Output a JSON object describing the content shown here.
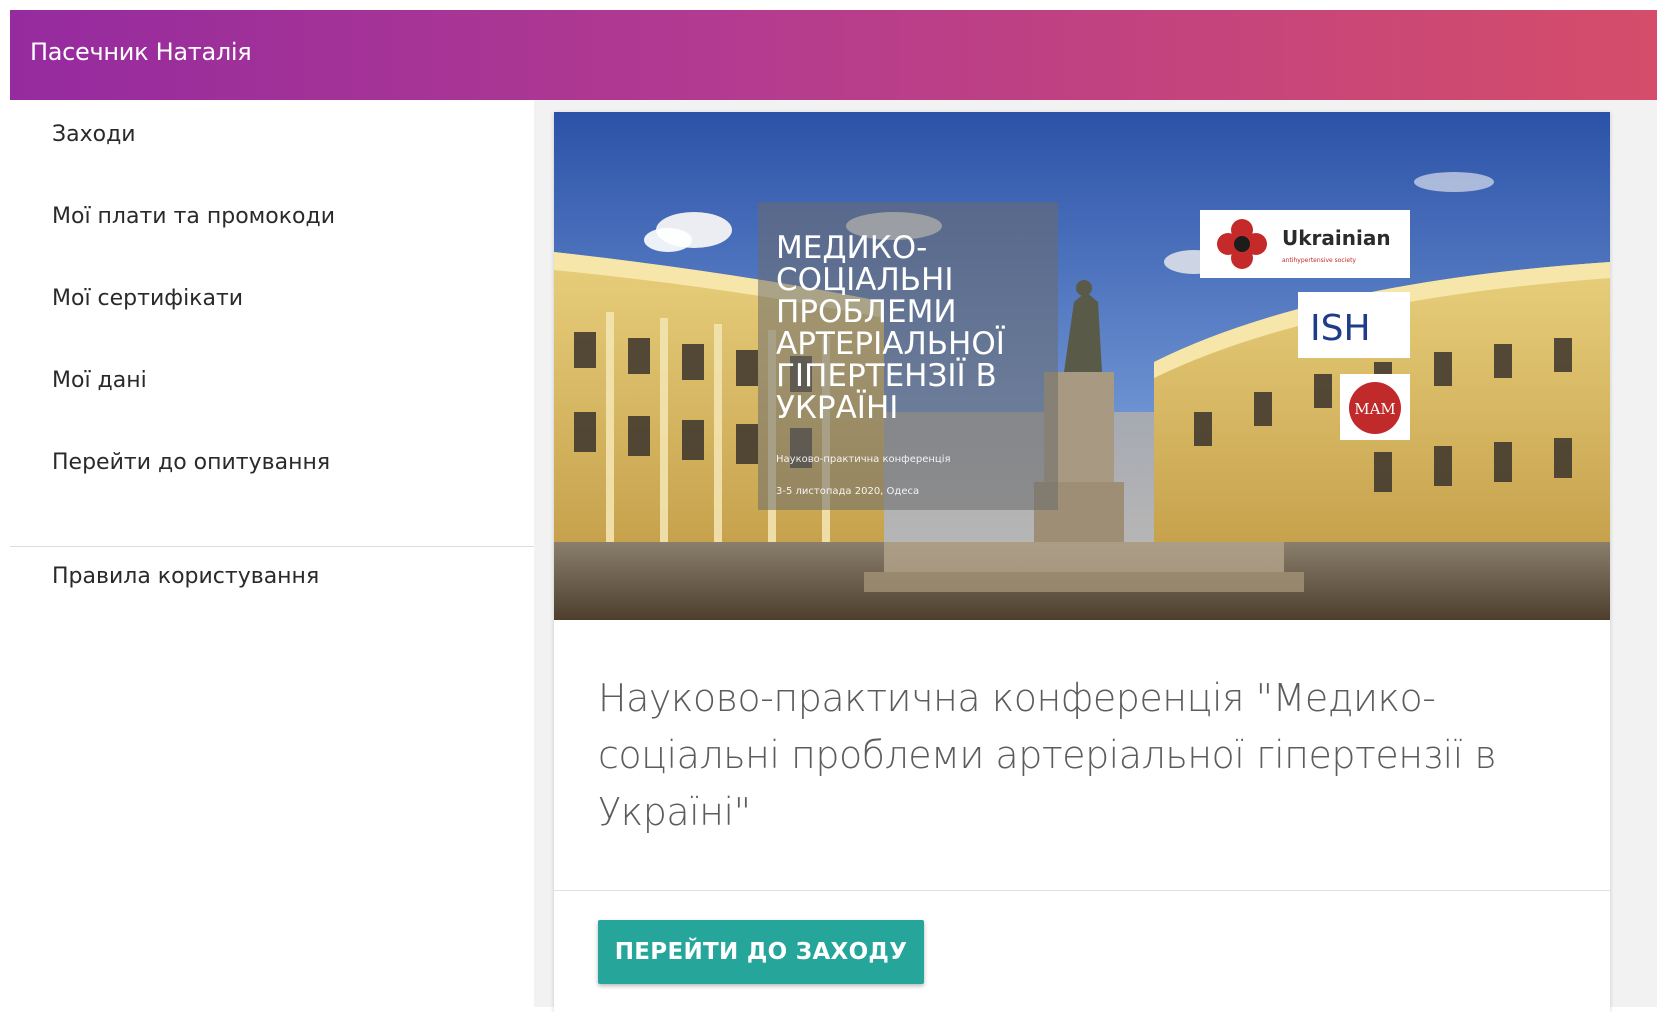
{
  "header": {
    "user_name": "Пасечник Наталія",
    "gradient_colors": [
      "#952b9f",
      "#d54d6a"
    ]
  },
  "sidebar": {
    "items": [
      {
        "label": "Заходи"
      },
      {
        "label": "Мої плати та промокоди"
      },
      {
        "label": "Мої сертифікати"
      },
      {
        "label": "Мої дані"
      },
      {
        "label": "Перейти до опитування"
      }
    ],
    "footer_items": [
      {
        "label": "Правила користування"
      }
    ]
  },
  "event_card": {
    "banner": {
      "title_lines": [
        "МЕДИКО-",
        "СОЦІАЛЬНІ",
        "ПРОБЛЕМИ",
        "АРТЕРІАЛЬНОЇ",
        "ГІПЕРТЕНЗІЇ В",
        "УКРАЇНІ"
      ],
      "subtitle": "Науково-практична конференція",
      "date": "3-5 листопада 2020, Одеса",
      "logos": {
        "ukrainian": "Ukrainian",
        "ukrainian_sub": "antihypertensive society",
        "ish": "ISH",
        "mam": "MAM"
      }
    },
    "title": "Науково-практична конференція \"Медико-соціальні проблеми артеріальної гіпертензії в Україні\"",
    "button_label": "ПЕРЕЙТИ ДО ЗАХОДУ",
    "button_color": "#26a69a"
  }
}
